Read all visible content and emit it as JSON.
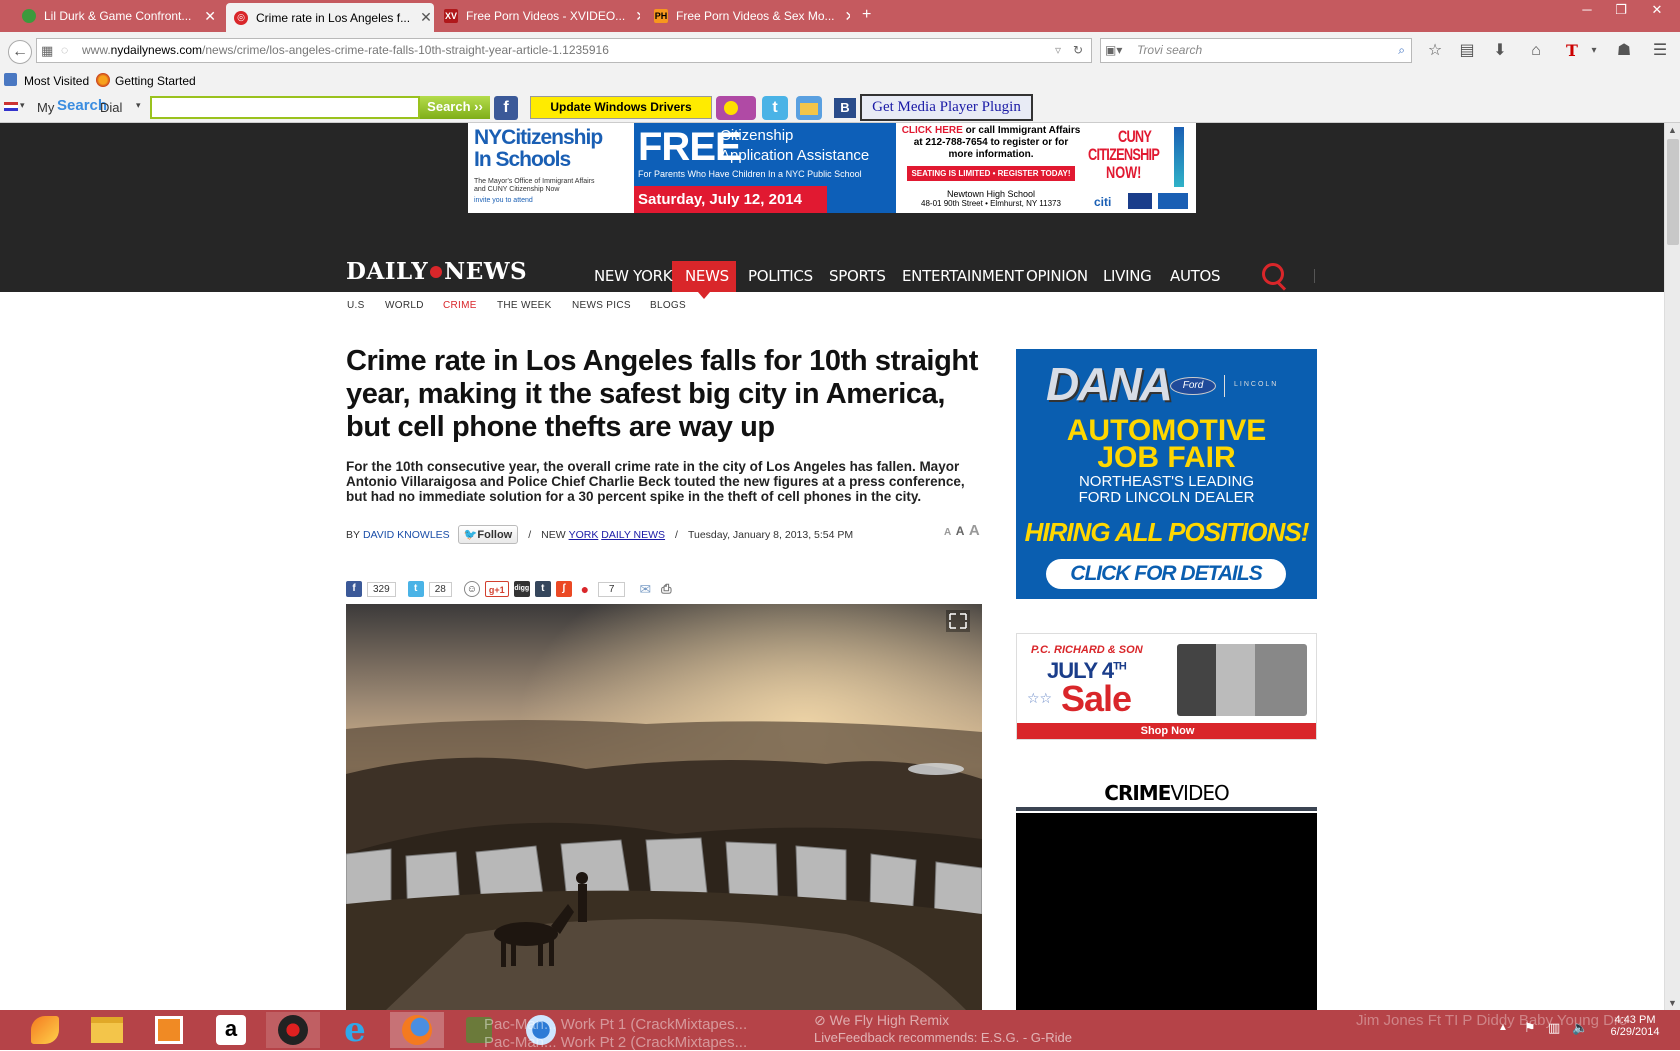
{
  "browser": {
    "tabs": [
      {
        "label": "Lil Durk & Game Confront...",
        "icon": "green-circle-icon",
        "color": "#3c9a3c"
      },
      {
        "label": "Crime rate in Los Angeles f...",
        "icon": "daily-news-icon",
        "color": "#d9262a"
      },
      {
        "label": "Free Porn Videos - XVIDEO...",
        "icon": "xv-icon",
        "icon_text": "XV",
        "color": "#b0181b"
      },
      {
        "label": "Free Porn Videos & Sex Mo...",
        "icon": "ph-icon",
        "icon_text": "PH",
        "color": "#f7971d"
      }
    ],
    "url_prefix": "www.",
    "url_domain": "nydailynews.com",
    "url_path": "/news/crime/los-angeles-crime-rate-falls-10th-straight-year-article-1.1235916",
    "search_placeholder": "Trovi search",
    "bookmarks": [
      "Most Visited",
      "Getting Started"
    ],
    "dial": {
      "my": "My",
      "search": "Search",
      "dial": "Dial",
      "search_button": "Search",
      "update_drivers": "Update Windows Drivers",
      "media_plugin": "Get Media Player Plugin",
      "b_label": "B"
    }
  },
  "ad_banner": {
    "nyc1": "NYCitizenship",
    "nyc2": "In Schools",
    "nyc_small1": "The Mayor's Office of Immigrant Affairs",
    "nyc_small2": "and CUNY Citizenship Now",
    "nyc_small3": "invite you to attend",
    "free": "FREE",
    "free_t1": "Citizenship",
    "free_t2": "Application Assistance",
    "parents": "For Parents Who Have Children In a NYC Public School",
    "date": "Saturday, July 12, 2014",
    "click_here": "CLICK HERE",
    "call1": "or call Immigrant Affairs",
    "call2": "at 212-788-7654 to register or for",
    "call3": "more information.",
    "limited": "SEATING IS LIMITED • REGISTER TODAY!",
    "school": "Newtown High School",
    "address": "48-01 90th Street • Elmhurst, NY 11373",
    "cuny1": "CUNY",
    "cuny2": "CITIZENSHIP",
    "cuny3": "NOW!",
    "citi": "citi"
  },
  "site": {
    "logo_left": "DAILY",
    "logo_right": "NEWS",
    "nav": [
      "NEW YORK",
      "NEWS",
      "POLITICS",
      "SPORTS",
      "ENTERTAINMENT",
      "OPINION",
      "LIVING",
      "AUTOS"
    ],
    "active_nav": "NEWS",
    "subnav": [
      "U.S",
      "WORLD",
      "CRIME",
      "THE WEEK",
      "NEWS PICS",
      "BLOGS"
    ],
    "active_subnav": "CRIME"
  },
  "article": {
    "headline": "Crime rate in Los Angeles falls for 10th straight year, making it the safest big city in America, but cell phone thefts are way up",
    "subhead": "For the 10th consecutive year, the overall crime rate in the city of Los Angeles has fallen. Mayor Antonio Villaraigosa and Police Chief Charlie Beck touted the new figures at a press conference, but had no immediate solution for a 30 percent spike in the theft of cell phones in the city.",
    "by": "BY",
    "author": "DAVID KNOWLES",
    "follow": "Follow",
    "sep": "/",
    "new_prefix": "NEW",
    "york_link": "YORK",
    "daily_news_link": "DAILY NEWS",
    "date": "Tuesday, January 8, 2013, 5:54 PM",
    "font_sizes": [
      "A",
      "A",
      "A"
    ],
    "share_counts": {
      "facebook": "329",
      "twitter": "28",
      "comments": "7"
    },
    "share_labels": {
      "gplus": "g+1",
      "digg": "digg"
    }
  },
  "sidebar": {
    "dana": "DANA",
    "ford": "Ford",
    "lincoln": "LINCOLN",
    "automotive": "AUTOMOTIVE",
    "job_fair": "JOB FAIR",
    "northeast": "NORTHEAST'S LEADING",
    "dealer": "FORD LINCOLN DEALER",
    "hiring": "HIRING ALL POSITIONS!",
    "click_details": "CLICK FOR DETAILS",
    "pcr": "P.C. RICHARD & SON",
    "july": "JULY 4",
    "th": "TH",
    "sale": "Sale",
    "shop_now": "Shop Now",
    "crime": "CRIME",
    "video": "VIDEO"
  },
  "taskbar": {
    "faded1": "Pac-Man... Work Pt 1 (CrackMixtapes...",
    "faded2": "Pac-Man... Work Pt 2 (CrackMixtapes...",
    "we_fly": "We Fly High Remix",
    "live_feedback": "LiveFeedback recommends: E.S.G. - G-Ride",
    "jim_jones": "Jim Jones Ft TI P Diddy Baby Young Dro",
    "time": "4:43 PM",
    "date": "6/29/2014"
  },
  "colors": {
    "titlebar": "#c55a5f",
    "taskbar": "#b54348",
    "nav_red": "#d9262a",
    "ad_blue": "#0a5eb0",
    "ad_yellow": "#ffd700"
  }
}
